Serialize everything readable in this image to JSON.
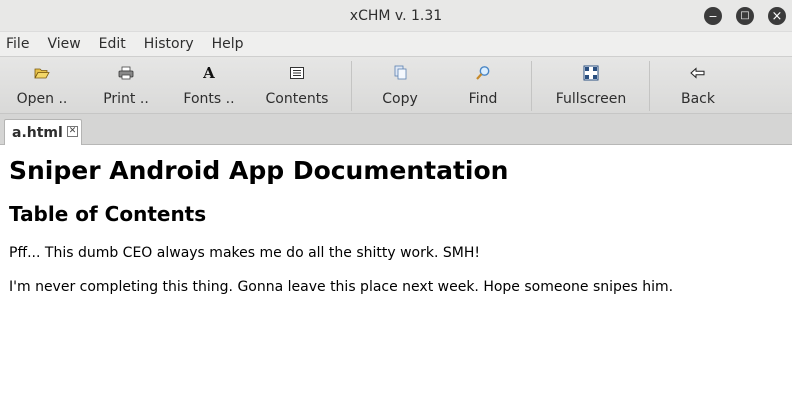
{
  "window": {
    "title": "xCHM v. 1.31",
    "controls": {
      "minimize": "−",
      "maximize": "□",
      "close": "×"
    }
  },
  "menubar": {
    "items": [
      "File",
      "View",
      "Edit",
      "History",
      "Help"
    ]
  },
  "toolbar": {
    "open_label": "Open ..",
    "print_label": "Print ..",
    "fonts_label": "Fonts ..",
    "contents_label": "Contents",
    "copy_label": "Copy",
    "find_label": "Find",
    "fullscreen_label": "Fullscreen",
    "back_label": "Back",
    "icons": [
      "folder-open-icon",
      "printer-icon",
      "font-icon",
      "contents-icon",
      "copy-icon",
      "find-icon",
      "fullscreen-icon",
      "back-arrow-icon"
    ]
  },
  "tabs": [
    {
      "label": "a.html",
      "active": true
    }
  ],
  "document": {
    "heading1": "Sniper Android App Documentation",
    "heading2": "Table of Contents",
    "paragraphs": [
      "Pff... This dumb CEO always makes me do all the shitty work. SMH!",
      "I'm never completing this thing. Gonna leave this place next week. Hope someone snipes him."
    ]
  },
  "colors": {
    "titlebar": "#e8e8e7",
    "toolbar": "#dededd",
    "window_button": "#3b3b3b",
    "text": "#000000"
  }
}
